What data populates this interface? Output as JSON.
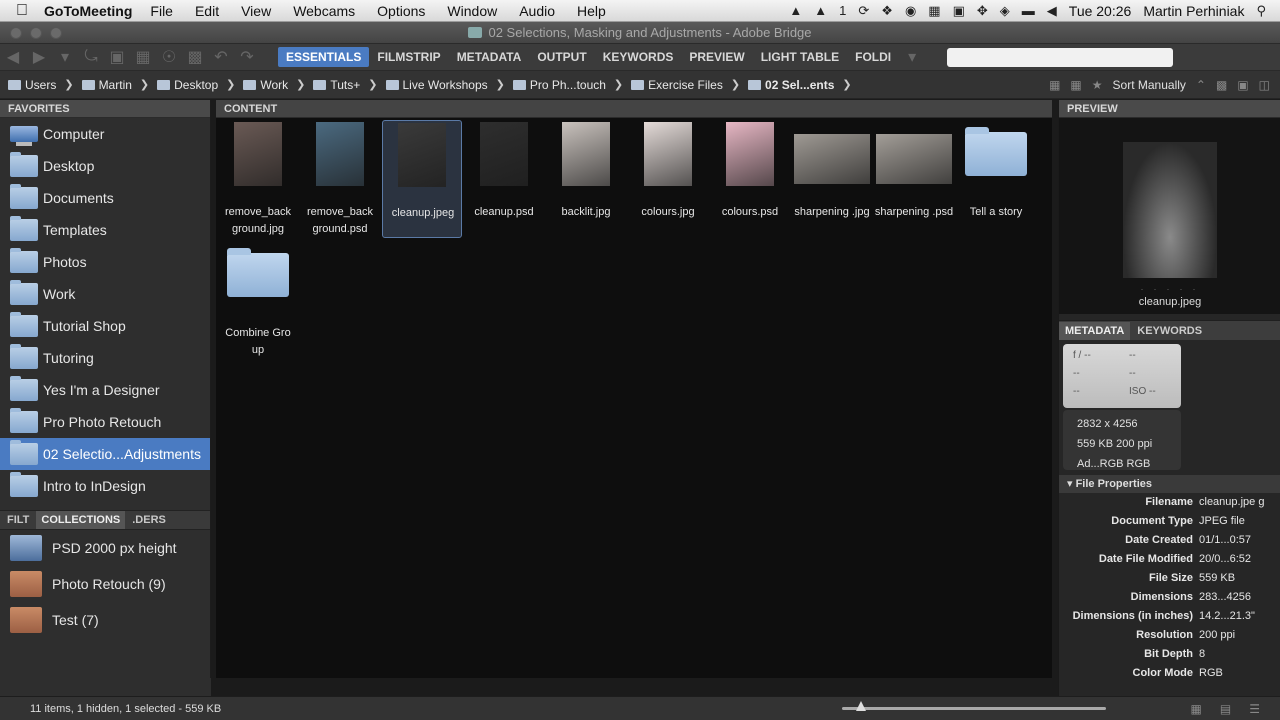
{
  "menubar": {
    "app": "GoToMeeting",
    "menus": [
      "File",
      "Edit",
      "View",
      "Webcams",
      "Options",
      "Window",
      "Audio",
      "Help"
    ],
    "adobe_badge": "1",
    "clock": "Tue 20:26",
    "user": "Martin Perhiniak"
  },
  "window": {
    "title": "02 Selections, Masking and Adjustments - Adobe Bridge"
  },
  "workspaces": [
    "ESSENTIALS",
    "FILMSTRIP",
    "METADATA",
    "OUTPUT",
    "KEYWORDS",
    "PREVIEW",
    "LIGHT TABLE",
    "FOLDI"
  ],
  "search": {
    "placeholder": ""
  },
  "breadcrumb": [
    "Users",
    "Martin",
    "Desktop",
    "Work",
    "Tuts+",
    "Live Workshops",
    "Pro Ph...touch",
    "Exercise Files",
    "02 Sel...ents"
  ],
  "sort_label": "Sort Manually",
  "favorites": {
    "header": "FAVORITES",
    "items": [
      {
        "label": "Computer",
        "icon": "computer-icon"
      },
      {
        "label": "Desktop",
        "icon": "folder-icon"
      },
      {
        "label": "Documents",
        "icon": "folder-icon"
      },
      {
        "label": "Templates",
        "icon": "folder-icon"
      },
      {
        "label": "Photos",
        "icon": "folder-icon"
      },
      {
        "label": "Work",
        "icon": "folder-icon"
      },
      {
        "label": "Tutorial Shop",
        "icon": "folder-icon"
      },
      {
        "label": "Tutoring",
        "icon": "folder-icon"
      },
      {
        "label": "Yes I'm a Designer",
        "icon": "folder-icon"
      },
      {
        "label": "Pro Photo Retouch",
        "icon": "folder-icon"
      },
      {
        "label": "02 Selectio...Adjustments",
        "icon": "folder-icon",
        "selected": true
      },
      {
        "label": "Intro to InDesign",
        "icon": "folder-icon"
      }
    ]
  },
  "collections": {
    "tabs": [
      "FILT",
      "COLLECTIONS",
      ".DERS"
    ],
    "items": [
      {
        "label": "PSD 2000 px height",
        "smart": true
      },
      {
        "label": "Photo Retouch (9)",
        "smart": false
      },
      {
        "label": "Test (7)",
        "smart": false
      }
    ]
  },
  "content": {
    "header": "CONTENT",
    "items": [
      {
        "name": "remove_back ground.jpg",
        "kind": "portrait",
        "tone": "#6a5a55"
      },
      {
        "name": "remove_back ground.psd",
        "kind": "portrait",
        "tone": "#4b6a80"
      },
      {
        "name": "cleanup.jpeg",
        "kind": "portrait",
        "tone": "#3a3a3a",
        "selected": true
      },
      {
        "name": "cleanup.psd",
        "kind": "portrait",
        "tone": "#2e2e2e"
      },
      {
        "name": "backlit.jpg",
        "kind": "portrait",
        "tone": "#c9c2bd"
      },
      {
        "name": "colours.jpg",
        "kind": "portrait",
        "tone": "#e4dbd8"
      },
      {
        "name": "colours.psd",
        "kind": "portrait",
        "tone": "#e7b7c4"
      },
      {
        "name": "sharpening .jpg",
        "kind": "wide",
        "tone": "#9f9a94"
      },
      {
        "name": "sharpening .psd",
        "kind": "wide",
        "tone": "#a39e98"
      },
      {
        "name": "Tell a story",
        "kind": "folder"
      },
      {
        "name": "Combine Gro up",
        "kind": "folder"
      }
    ]
  },
  "preview": {
    "header": "PREVIEW",
    "filename": "cleanup.jpeg",
    "dots": ". . . . ."
  },
  "metadata": {
    "tabs": [
      "METADATA",
      "KEYWORDS"
    ],
    "camera": {
      "aperture": "f / --",
      "shutter": "--",
      "a": "--",
      "b": "--",
      "c": "--",
      "iso": "ISO --"
    },
    "info": [
      "2832 x 4256",
      "559 KB   200 ppi",
      "Ad...RGB  RGB"
    ],
    "file_properties_label": "File Properties",
    "file_properties": [
      {
        "k": "Filename",
        "v": "cleanup.jpe g"
      },
      {
        "k": "Document Type",
        "v": "JPEG file"
      },
      {
        "k": "Date Created",
        "v": "01/1...0:57"
      },
      {
        "k": "Date File Modified",
        "v": "20/0...6:52"
      },
      {
        "k": "File Size",
        "v": "559 KB"
      },
      {
        "k": "Dimensions",
        "v": "283...4256"
      },
      {
        "k": "Dimensions (in inches)",
        "v": "14.2...21.3\""
      },
      {
        "k": "Resolution",
        "v": "200 ppi"
      },
      {
        "k": "Bit Depth",
        "v": "8"
      },
      {
        "k": "Color Mode",
        "v": "RGB"
      }
    ]
  },
  "status": {
    "text": "11 items, 1 hidden, 1 selected - 559 KB"
  }
}
